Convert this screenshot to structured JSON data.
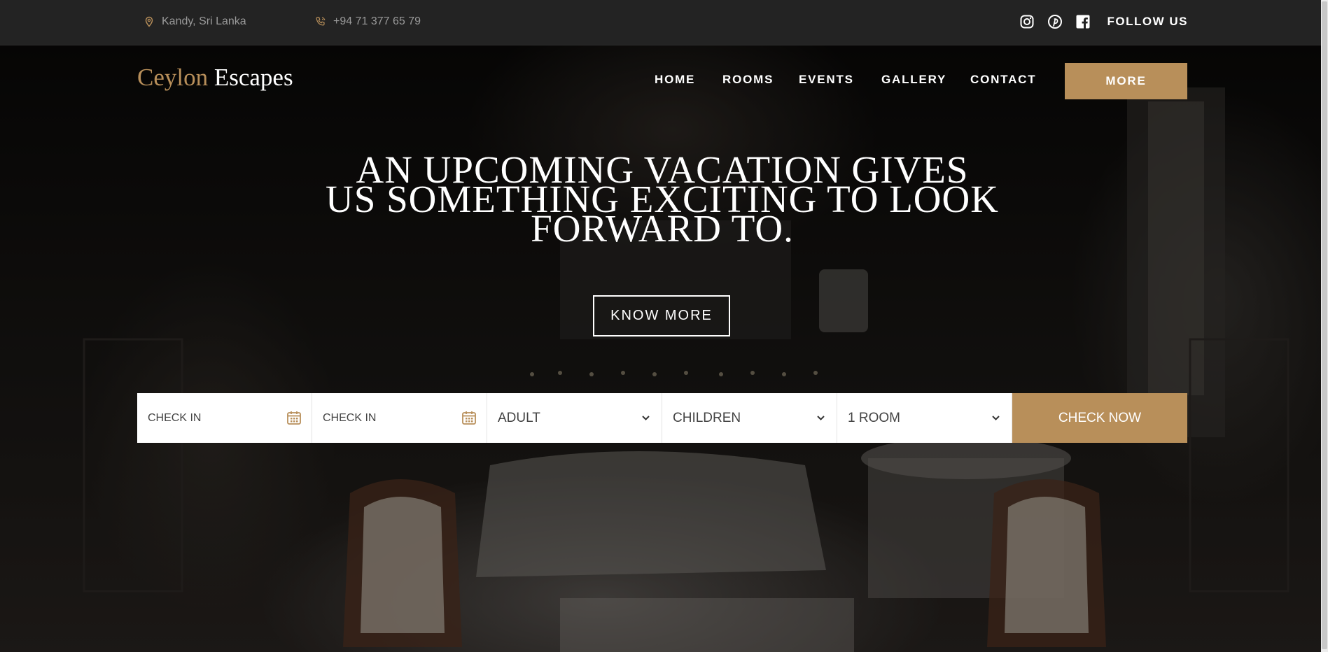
{
  "topbar": {
    "location": "Kandy, Sri Lanka",
    "phone": "+94 71 377 65 79",
    "follow_label": "FOLLOW US",
    "social_icons": [
      "instagram-icon",
      "pinterest-icon",
      "facebook-icon"
    ]
  },
  "brand": {
    "part1": "Ceylon",
    "part2": "Escapes"
  },
  "nav": {
    "items": [
      "HOME",
      "ROOMS",
      "EVENTS",
      "GALLERY",
      "CONTACT"
    ],
    "more_label": "MORE"
  },
  "hero": {
    "headline_line1": "AN UPCOMING VACATION GIVES",
    "headline_line2": "US SOMETHING EXCITING TO LOOK",
    "headline_line3": "FORWARD TO.",
    "cta_label": "KNOW MORE"
  },
  "booking": {
    "checkin_1": "CHECK IN",
    "checkin_2": "CHECK IN",
    "adult": "ADULT",
    "children": "CHILDREN",
    "rooms": "1 ROOM",
    "submit_label": "CHECK NOW"
  },
  "colors": {
    "accent": "#b88f5a",
    "topbar_bg": "#232323",
    "text_light": "#ffffff"
  }
}
